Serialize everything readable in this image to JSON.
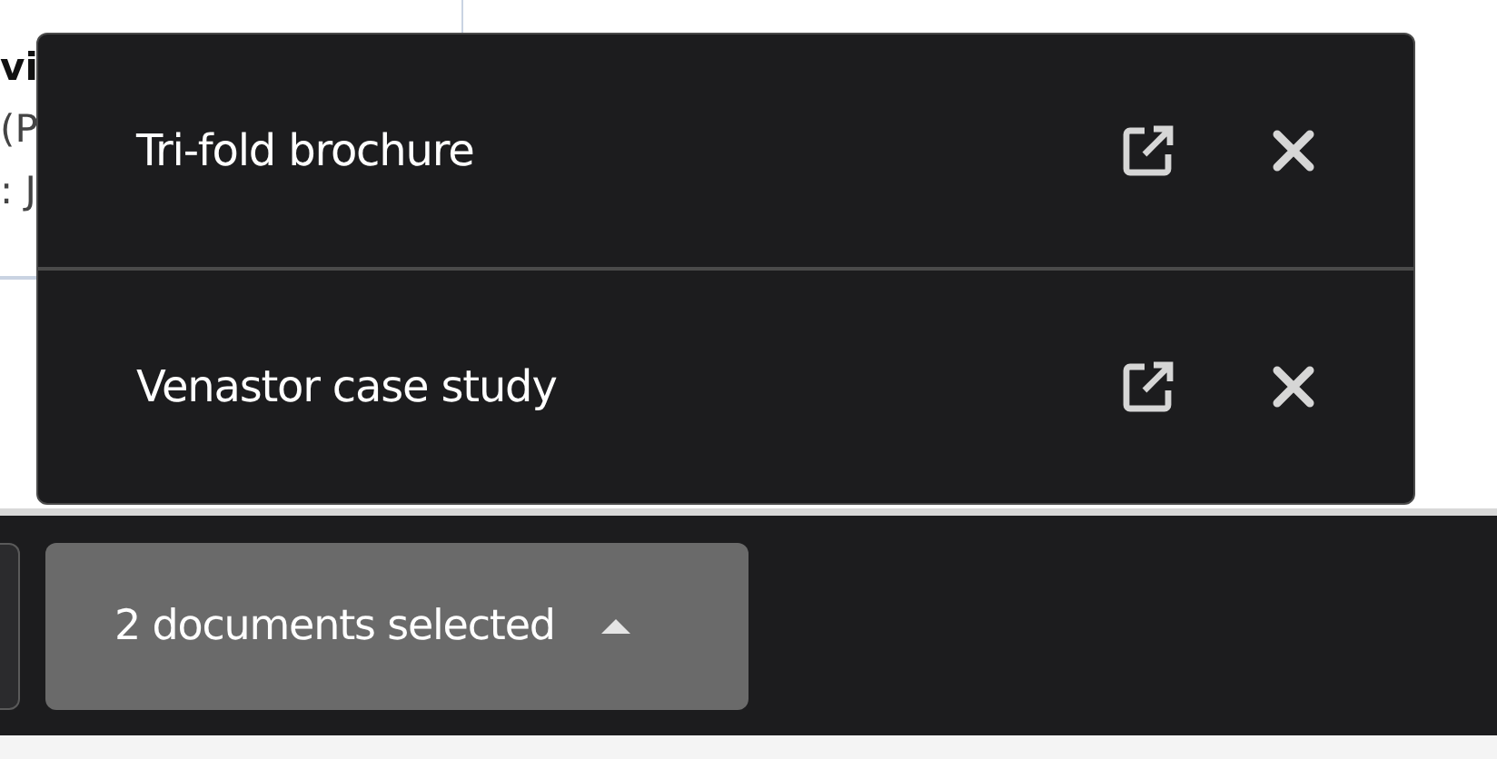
{
  "background_card": {
    "lines": [
      "vi",
      "(P",
      ": J"
    ]
  },
  "documents_popup": {
    "items": [
      {
        "title": "Tri-fold brochure"
      },
      {
        "title": "Venastor case study"
      }
    ]
  },
  "bottom_bar": {
    "selection_button": {
      "label": "2 documents selected",
      "expanded": true
    }
  }
}
